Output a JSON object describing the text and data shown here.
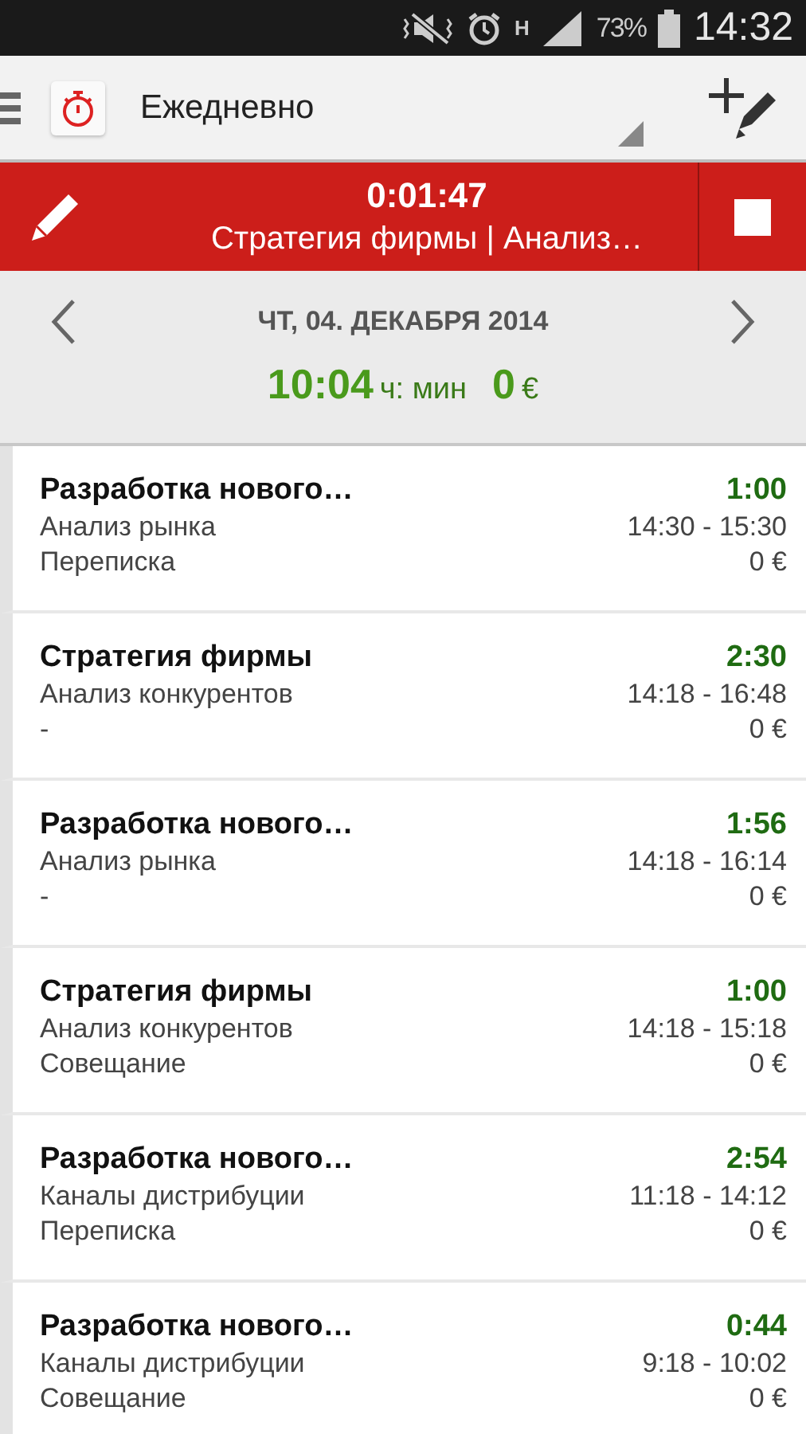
{
  "status_bar": {
    "network": "H",
    "battery": "73%",
    "time": "14:32"
  },
  "toolbar": {
    "title": "Ежедневно"
  },
  "timer": {
    "elapsed": "0:01:47",
    "task": "Стратегия фирмы | Анализ…"
  },
  "date_header": {
    "date": "ЧТ, 04. ДЕКАБРЯ 2014",
    "total": "10:04",
    "total_unit": "ч: мин",
    "amount": "0",
    "currency": "€"
  },
  "entries": [
    {
      "title": "Разработка нового…",
      "task": "Анализ рынка",
      "note": "Переписка",
      "duration": "1:00",
      "range": "14:30 - 15:30",
      "amount": "0 €"
    },
    {
      "title": "Стратегия фирмы",
      "task": "Анализ конкурентов",
      "note": "-",
      "duration": "2:30",
      "range": "14:18 - 16:48",
      "amount": "0 €"
    },
    {
      "title": "Разработка нового…",
      "task": "Анализ рынка",
      "note": "-",
      "duration": "1:56",
      "range": "14:18 - 16:14",
      "amount": "0 €"
    },
    {
      "title": "Стратегия фирмы",
      "task": "Анализ конкурентов",
      "note": "Совещание",
      "duration": "1:00",
      "range": "14:18 - 15:18",
      "amount": "0 €"
    },
    {
      "title": "Разработка нового…",
      "task": "Каналы дистрибуции",
      "note": "Переписка",
      "duration": "2:54",
      "range": "11:18 - 14:12",
      "amount": "0 €"
    },
    {
      "title": "Разработка нового…",
      "task": "Каналы дистрибуции",
      "note": "Совещание",
      "duration": "0:44",
      "range": "9:18 - 10:02",
      "amount": "0 €"
    }
  ]
}
